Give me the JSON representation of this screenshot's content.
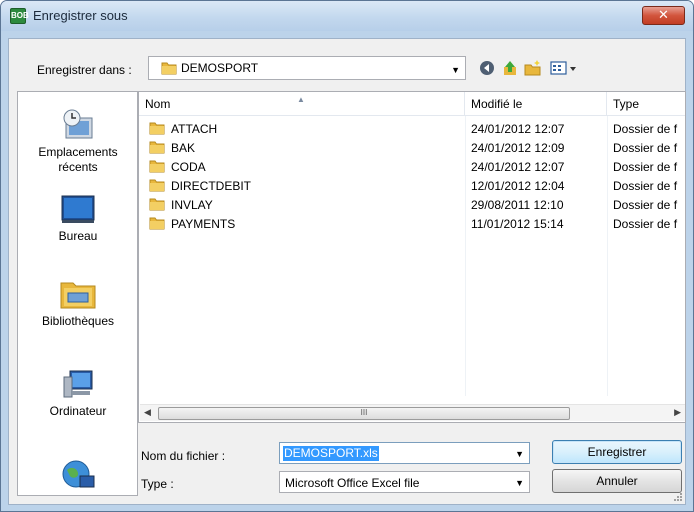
{
  "window": {
    "title": "Enregistrer sous",
    "app_icon_text": "BOB",
    "close_glyph": "✕"
  },
  "save_in": {
    "label": "Enregistrer dans :",
    "value": "DEMOSPORT"
  },
  "toolbar": {
    "icons": [
      "back-icon",
      "up-folder-icon",
      "new-folder-icon",
      "views-menu-icon"
    ]
  },
  "places": [
    {
      "label": "Emplacements récents",
      "icon": "recent-places-icon"
    },
    {
      "label": "Bureau",
      "icon": "desktop-icon"
    },
    {
      "label": "Bibliothèques",
      "icon": "libraries-icon"
    },
    {
      "label": "Ordinateur",
      "icon": "computer-icon"
    },
    {
      "label": "",
      "icon": "network-icon"
    }
  ],
  "file_list": {
    "columns": [
      "Nom",
      "Modifié le",
      "Type"
    ],
    "rows": [
      {
        "name": "ATTACH",
        "modified": "24/01/2012 12:07",
        "type": "Dossier de f"
      },
      {
        "name": "BAK",
        "modified": "24/01/2012 12:09",
        "type": "Dossier de f"
      },
      {
        "name": "CODA",
        "modified": "24/01/2012 12:07",
        "type": "Dossier de f"
      },
      {
        "name": "DIRECTDEBIT",
        "modified": "12/01/2012 12:04",
        "type": "Dossier de f"
      },
      {
        "name": "INVLAY",
        "modified": "29/08/2011 12:10",
        "type": "Dossier de f"
      },
      {
        "name": "PAYMENTS",
        "modified": "11/01/2012 15:14",
        "type": "Dossier de f"
      }
    ],
    "scroll_thumb_glyph": "III"
  },
  "file_name": {
    "label": "Nom du fichier :",
    "value": "DEMOSPORT.xls"
  },
  "file_type": {
    "label": "Type :",
    "value": "Microsoft Office Excel file"
  },
  "buttons": {
    "save": "Enregistrer",
    "cancel": "Annuler"
  },
  "colors": {
    "title_bar": "#c3d8ee",
    "close_button": "#d2553d",
    "selection": "#3399ff",
    "folder": "#e8b73c"
  }
}
